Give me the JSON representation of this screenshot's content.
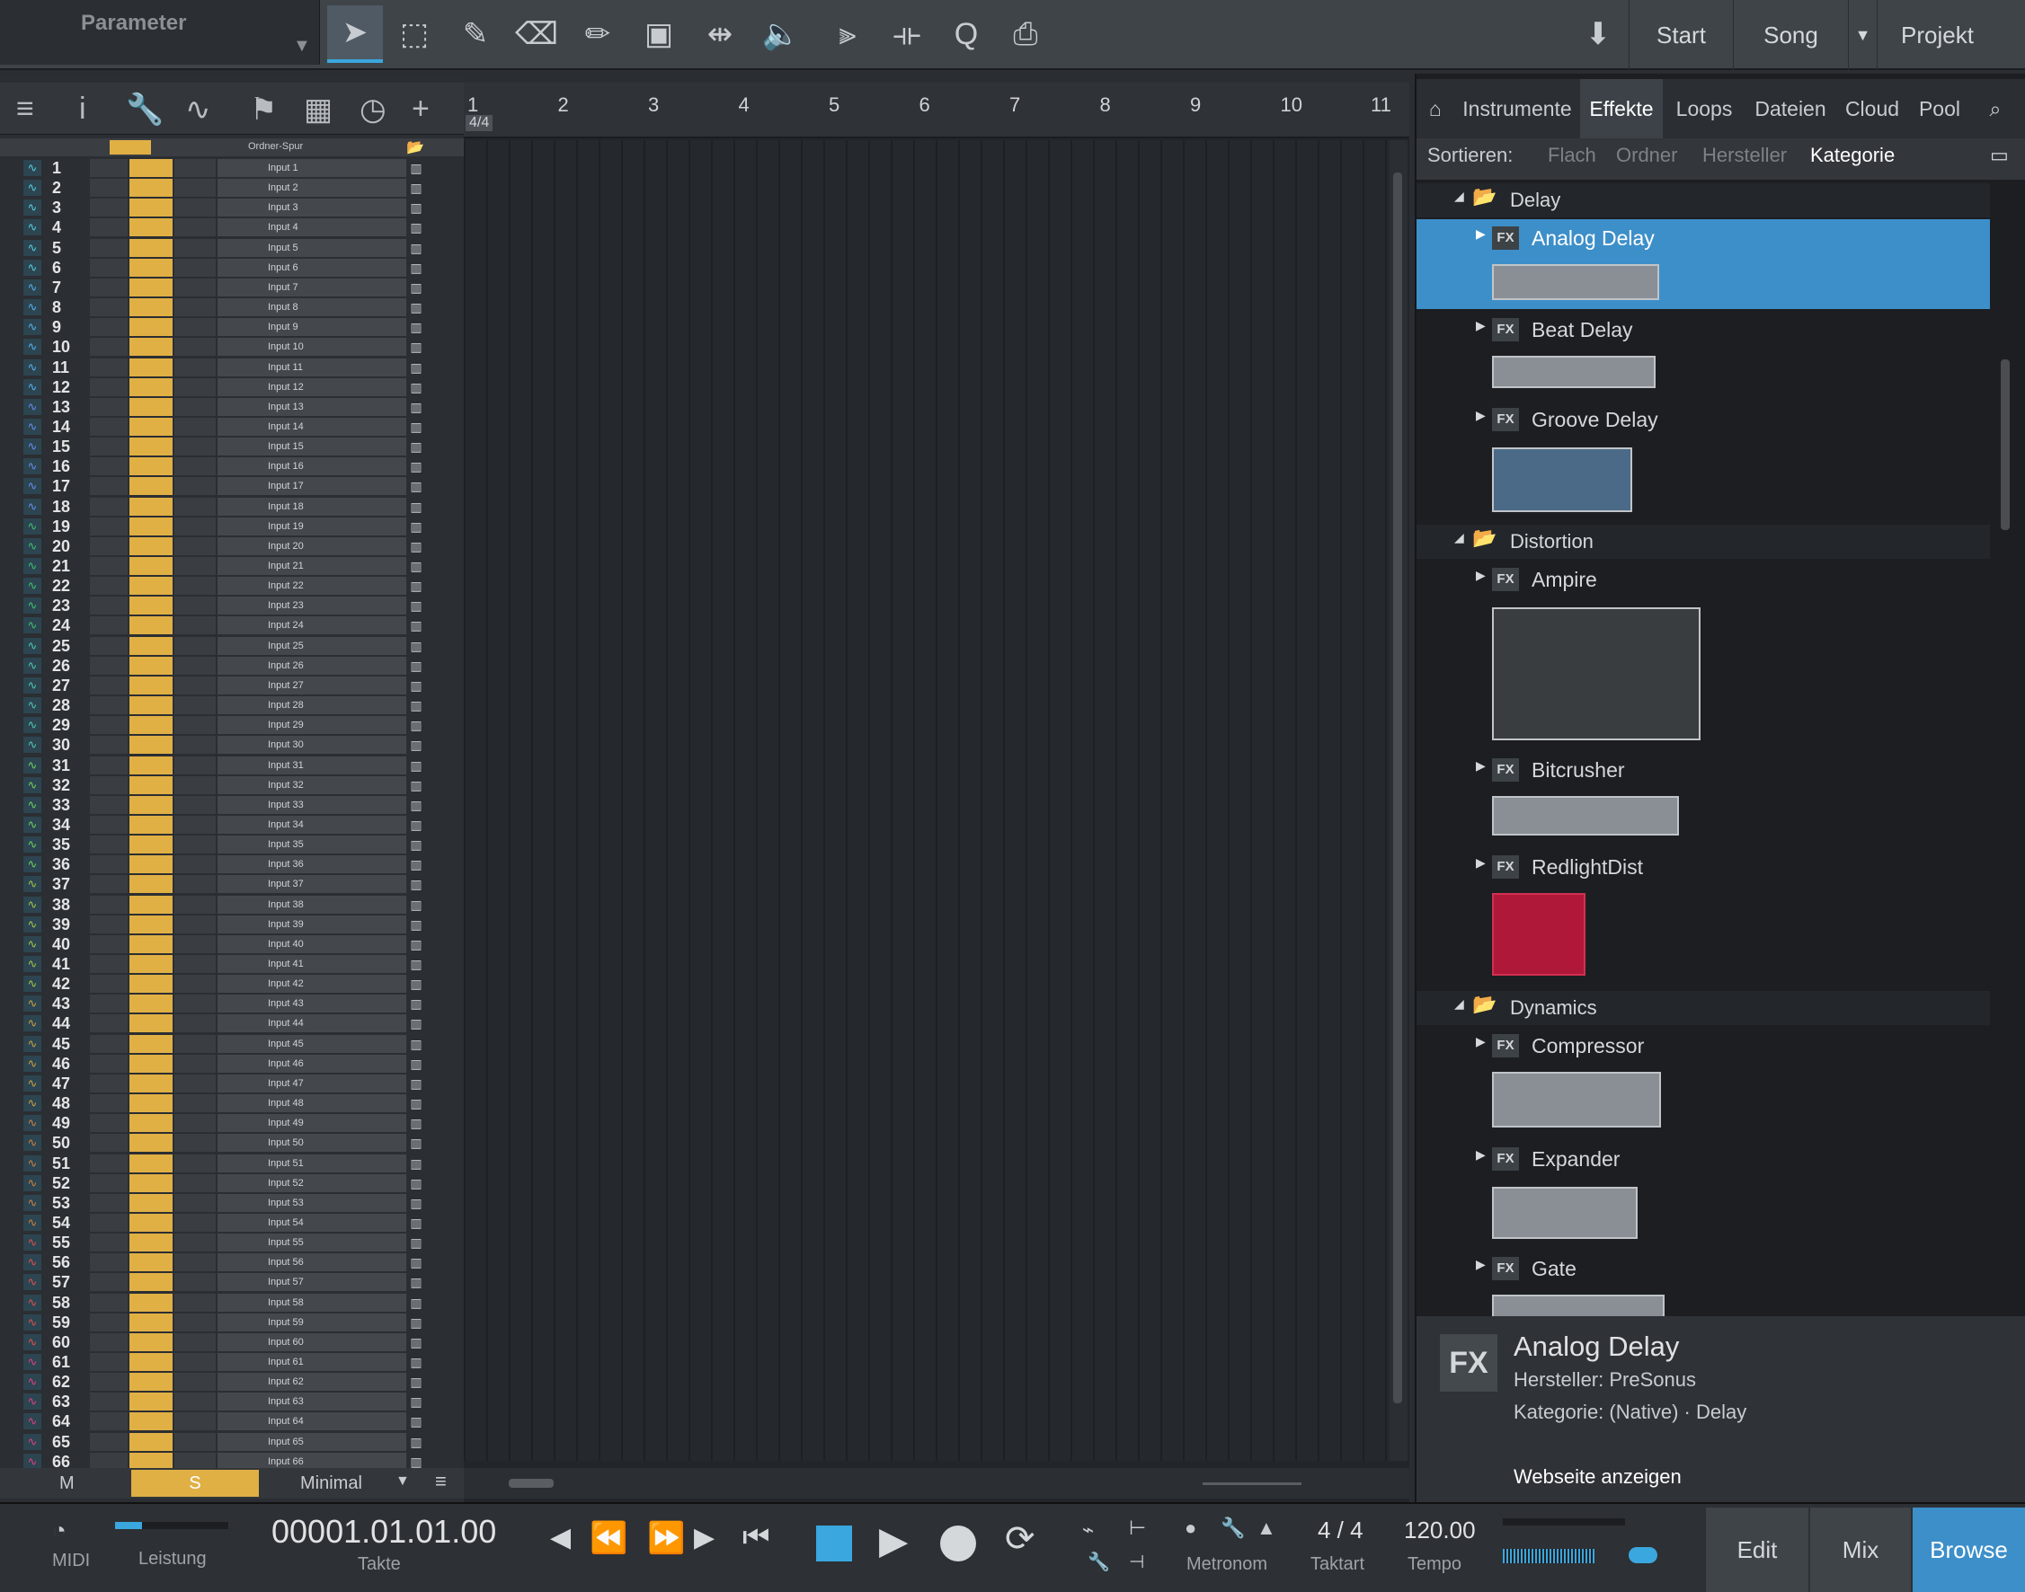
{
  "top": {
    "parameter_label": "Parameter",
    "nav": [
      "Start",
      "Song",
      "Projekt"
    ]
  },
  "tracks": {
    "folder_label": "Ordner-Spur",
    "rows": [
      {
        "num": "1",
        "input": "Input 1"
      },
      {
        "num": "2",
        "input": "Input 2"
      },
      {
        "num": "3",
        "input": "Input 3"
      },
      {
        "num": "4",
        "input": "Input 4"
      },
      {
        "num": "5",
        "input": "Input 5"
      },
      {
        "num": "6",
        "input": "Input 6"
      },
      {
        "num": "7",
        "input": "Input 7"
      },
      {
        "num": "8",
        "input": "Input 8"
      },
      {
        "num": "9",
        "input": "Input 9"
      },
      {
        "num": "10",
        "input": "Input 10"
      },
      {
        "num": "11",
        "input": "Input 11"
      },
      {
        "num": "12",
        "input": "Input 12"
      },
      {
        "num": "13",
        "input": "Input 13"
      },
      {
        "num": "14",
        "input": "Input 14"
      },
      {
        "num": "15",
        "input": "Input 15"
      },
      {
        "num": "16",
        "input": "Input 16"
      },
      {
        "num": "17",
        "input": "Input 17"
      },
      {
        "num": "18",
        "input": "Input 18"
      },
      {
        "num": "19",
        "input": "Input 19"
      },
      {
        "num": "20",
        "input": "Input 20"
      },
      {
        "num": "21",
        "input": "Input 21"
      },
      {
        "num": "22",
        "input": "Input 22"
      },
      {
        "num": "23",
        "input": "Input 23"
      },
      {
        "num": "24",
        "input": "Input 24"
      },
      {
        "num": "25",
        "input": "Input 25"
      },
      {
        "num": "26",
        "input": "Input 26"
      },
      {
        "num": "27",
        "input": "Input 27"
      },
      {
        "num": "28",
        "input": "Input 28"
      },
      {
        "num": "29",
        "input": "Input 29"
      },
      {
        "num": "30",
        "input": "Input 30"
      },
      {
        "num": "31",
        "input": "Input 31"
      },
      {
        "num": "32",
        "input": "Input 32"
      },
      {
        "num": "33",
        "input": "Input 33"
      },
      {
        "num": "34",
        "input": "Input 34"
      },
      {
        "num": "35",
        "input": "Input 35"
      },
      {
        "num": "36",
        "input": "Input 36"
      },
      {
        "num": "37",
        "input": "Input 37"
      },
      {
        "num": "38",
        "input": "Input 38"
      },
      {
        "num": "39",
        "input": "Input 39"
      },
      {
        "num": "40",
        "input": "Input 40"
      },
      {
        "num": "41",
        "input": "Input 41"
      },
      {
        "num": "42",
        "input": "Input 42"
      },
      {
        "num": "43",
        "input": "Input 43"
      },
      {
        "num": "44",
        "input": "Input 44"
      },
      {
        "num": "45",
        "input": "Input 45"
      },
      {
        "num": "46",
        "input": "Input 46"
      },
      {
        "num": "47",
        "input": "Input 47"
      },
      {
        "num": "48",
        "input": "Input 48"
      },
      {
        "num": "49",
        "input": "Input 49"
      },
      {
        "num": "50",
        "input": "Input 50"
      },
      {
        "num": "51",
        "input": "Input 51"
      },
      {
        "num": "52",
        "input": "Input 52"
      },
      {
        "num": "53",
        "input": "Input 53"
      },
      {
        "num": "54",
        "input": "Input 54"
      },
      {
        "num": "55",
        "input": "Input 55"
      },
      {
        "num": "56",
        "input": "Input 56"
      },
      {
        "num": "57",
        "input": "Input 57"
      },
      {
        "num": "58",
        "input": "Input 58"
      },
      {
        "num": "59",
        "input": "Input 59"
      },
      {
        "num": "60",
        "input": "Input 60"
      },
      {
        "num": "61",
        "input": "Input 61"
      },
      {
        "num": "62",
        "input": "Input 62"
      },
      {
        "num": "63",
        "input": "Input 63"
      },
      {
        "num": "64",
        "input": "Input 64"
      },
      {
        "num": "65",
        "input": "Input 65"
      },
      {
        "num": "66",
        "input": "Input 66"
      }
    ],
    "footer": {
      "m": "M",
      "s": "S",
      "view": "Minimal"
    }
  },
  "ruler": {
    "bars": [
      "1",
      "2",
      "3",
      "4",
      "5",
      "6",
      "7",
      "8",
      "9",
      "10",
      "11"
    ],
    "signature": "4/4"
  },
  "browser": {
    "tabs": [
      "Instrumente",
      "Effekte",
      "Loops",
      "Dateien",
      "Cloud",
      "Pool"
    ],
    "selected_tab": "Effekte",
    "sort_label": "Sortieren:",
    "sort_options": [
      "Flach",
      "Ordner",
      "Hersteller",
      "Kategorie"
    ],
    "categories": [
      {
        "name": "Delay",
        "items": [
          "Analog Delay",
          "Beat Delay",
          "Groove Delay"
        ]
      },
      {
        "name": "Distortion",
        "items": [
          "Ampire",
          "Bitcrusher",
          "RedlightDist"
        ]
      },
      {
        "name": "Dynamics",
        "items": [
          "Compressor",
          "Expander",
          "Gate"
        ]
      }
    ],
    "fx_badge": "FX",
    "info": {
      "title": "Analog Delay",
      "vendor": "Hersteller:  PreSonus",
      "category": "Kategorie:  (Native) · Delay",
      "link": "Webseite anzeigen"
    }
  },
  "transport": {
    "midi": "MIDI",
    "performance": "Leistung",
    "position": "00001.01.01.00",
    "position_label": "Takte",
    "metronome": "Metronom",
    "signature": "4 / 4",
    "signature_label": "Taktart",
    "tempo": "120.00",
    "tempo_label": "Tempo",
    "modes": [
      "Edit",
      "Mix",
      "Browse"
    ]
  },
  "colors": {
    "accent": "#3aa7de",
    "selected": "#3d8fc9",
    "track_yellow": "#e0b045"
  }
}
